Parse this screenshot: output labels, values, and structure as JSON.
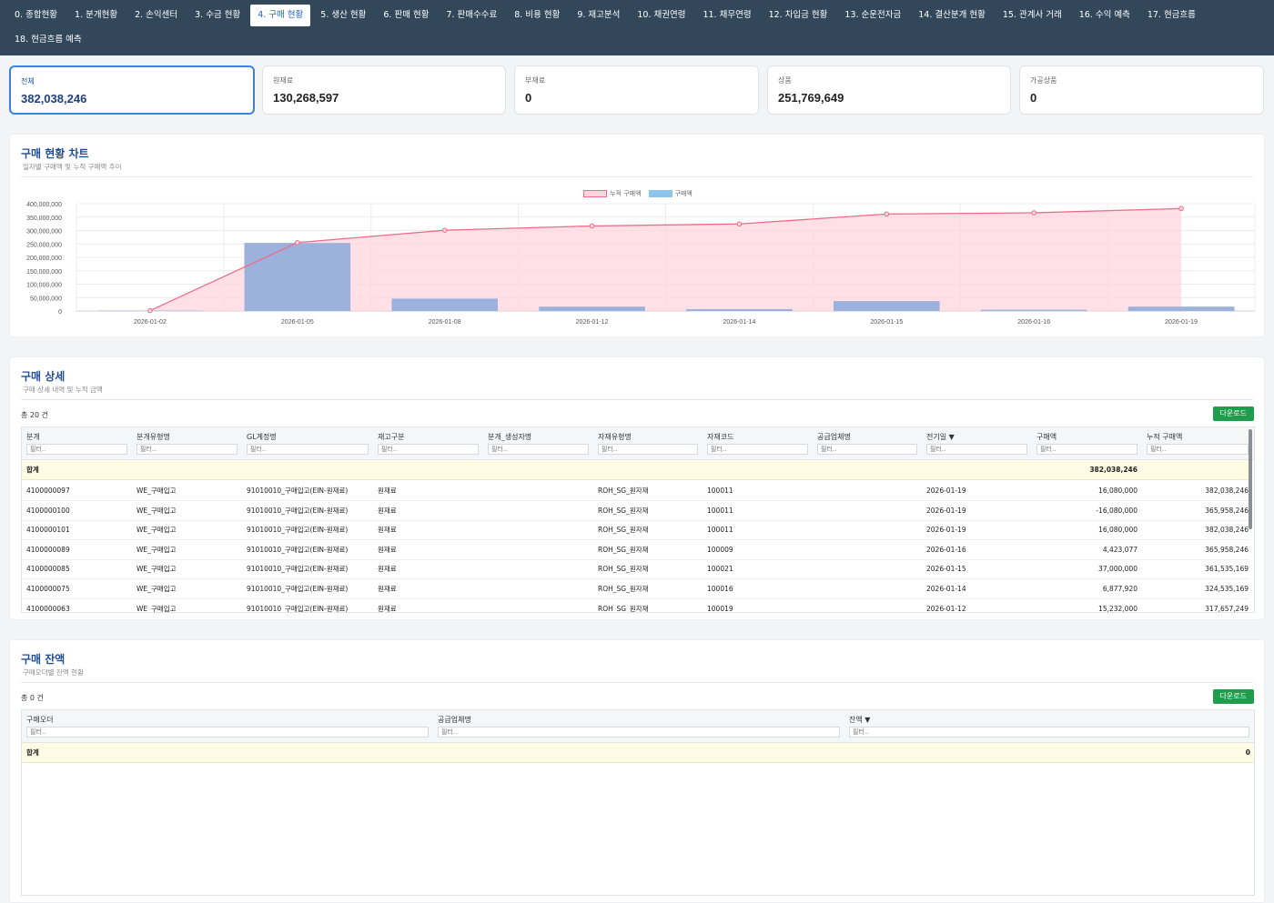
{
  "nav": {
    "tabs": [
      {
        "label": "0. 종합현황",
        "active": false
      },
      {
        "label": "1. 분개현황",
        "active": false
      },
      {
        "label": "2. 손익센터",
        "active": false
      },
      {
        "label": "3. 수금 현황",
        "active": false
      },
      {
        "label": "4. 구매 현황",
        "active": true
      },
      {
        "label": "5. 생산 현황",
        "active": false
      },
      {
        "label": "6. 판매 현황",
        "active": false
      },
      {
        "label": "7. 판매수수료",
        "active": false
      },
      {
        "label": "8. 비용 현황",
        "active": false
      },
      {
        "label": "9. 재고분석",
        "active": false
      },
      {
        "label": "10. 채권연령",
        "active": false
      },
      {
        "label": "11. 채무연령",
        "active": false
      },
      {
        "label": "12. 차입금 현황",
        "active": false
      },
      {
        "label": "13. 순운전자금",
        "active": false
      },
      {
        "label": "14. 결산분개 현황",
        "active": false
      },
      {
        "label": "15. 관계사 거래",
        "active": false
      },
      {
        "label": "16. 수익 예측",
        "active": false
      },
      {
        "label": "17. 현금흐름",
        "active": false
      },
      {
        "label": "18. 현금흐름 예측",
        "active": false
      }
    ]
  },
  "kpis": [
    {
      "label": "전체",
      "value": "382,038,246",
      "active": true
    },
    {
      "label": "원재료",
      "value": "130,268,597",
      "active": false
    },
    {
      "label": "부재료",
      "value": "0",
      "active": false
    },
    {
      "label": "상품",
      "value": "251,769,649",
      "active": false
    },
    {
      "label": "가공상품",
      "value": "0",
      "active": false
    }
  ],
  "chart_panel": {
    "title": "구매 현황 차트",
    "subtitle": "일자별 구매액 및 누적 구매액 추이"
  },
  "chart_data": {
    "type": "bar",
    "categories": [
      "2026-01-02",
      "2026-01-05",
      "2026-01-08",
      "2026-01-12",
      "2026-01-14",
      "2026-01-15",
      "2026-01-16",
      "2026-01-19"
    ],
    "series": [
      {
        "name": "누적 구매액",
        "type": "area",
        "values": [
          1500000,
          255000000,
          301000000,
          317000000,
          324500000,
          361500000,
          366000000,
          382038246
        ],
        "color": "#ee6b88",
        "fill": "#ffd6df"
      },
      {
        "name": "구매액",
        "type": "bar",
        "values": [
          1500000,
          253500000,
          46000000,
          16000000,
          6877920,
          37000000,
          4423077,
          16080000
        ],
        "color": "#8cc5ec"
      }
    ],
    "bar_overlay_values": [
      1500000,
      253500000,
      46000000,
      16000000,
      6877920,
      37000000,
      4423077,
      16080000
    ],
    "yticks": [
      "400,000,000",
      "350,000,000",
      "300,000,000",
      "250,000,000",
      "200,000,000",
      "150,000,000",
      "100,000,000",
      "50,000,000",
      "0"
    ],
    "ylim": [
      0,
      400000000
    ],
    "grid": true,
    "legend": "top-center"
  },
  "detail": {
    "title": "구매 상세",
    "subtitle": "구매 상세 내역 및 누적 금액",
    "count": "총 20 건",
    "download": "다운로드",
    "filter_placeholder": "필터..",
    "sum_label": "합계",
    "sum_amount": "382,038,246",
    "columns": [
      "분개",
      "분개유형명",
      "GL계정명",
      "재고구분",
      "분개_생성자명",
      "자재유형명",
      "자재코드",
      "공급업체명",
      "전기일 ▼",
      "구매액",
      "누적 구매액"
    ],
    "rows": [
      [
        "4100000097",
        "WE_구매입고",
        "91010010_구매입고(EIN-원재료)",
        "원재료",
        "",
        "ROH_SG_원자재",
        "100011",
        "",
        "2026-01-19",
        "16,080,000",
        "382,038,246"
      ],
      [
        "4100000100",
        "WE_구매입고",
        "91010010_구매입고(EIN-원재료)",
        "원재료",
        "",
        "ROH_SG_원자재",
        "100011",
        "",
        "2026-01-19",
        "-16,080,000",
        "365,958,246"
      ],
      [
        "4100000101",
        "WE_구매입고",
        "91010010_구매입고(EIN-원재료)",
        "원재료",
        "",
        "ROH_SG_원자재",
        "100011",
        "",
        "2026-01-19",
        "16,080,000",
        "382,038,246"
      ],
      [
        "4100000089",
        "WE_구매입고",
        "91010010_구매입고(EIN-원재료)",
        "원재료",
        "",
        "ROH_SG_원자재",
        "100009",
        "",
        "2026-01-16",
        "4,423,077",
        "365,958,246"
      ],
      [
        "4100000085",
        "WE_구매입고",
        "91010010_구매입고(EIN-원재료)",
        "원재료",
        "",
        "ROH_SG_원자재",
        "100021",
        "",
        "2026-01-15",
        "37,000,000",
        "361,535,169"
      ],
      [
        "4100000075",
        "WE_구매입고",
        "91010010_구매입고(EIN-원재료)",
        "원재료",
        "",
        "ROH_SG_원자재",
        "100016",
        "",
        "2026-01-14",
        "6,877,920",
        "324,535,169"
      ],
      [
        "4100000063",
        "WE_구매입고",
        "91010010_구매입고(EIN-원재료)",
        "원재료",
        "",
        "ROH_SG_원자재",
        "100019",
        "",
        "2026-01-12",
        "15,232,000",
        "317,657,249"
      ]
    ]
  },
  "balance": {
    "title": "구매 잔액",
    "subtitle": "구매오더별 잔액 현황",
    "count": "총 0 건",
    "download": "다운로드",
    "filter_placeholder": "필터..",
    "sum_label": "합계",
    "sum_amount": "0",
    "columns": [
      "구매오더",
      "공급업체명",
      "잔액 ▼"
    ]
  }
}
